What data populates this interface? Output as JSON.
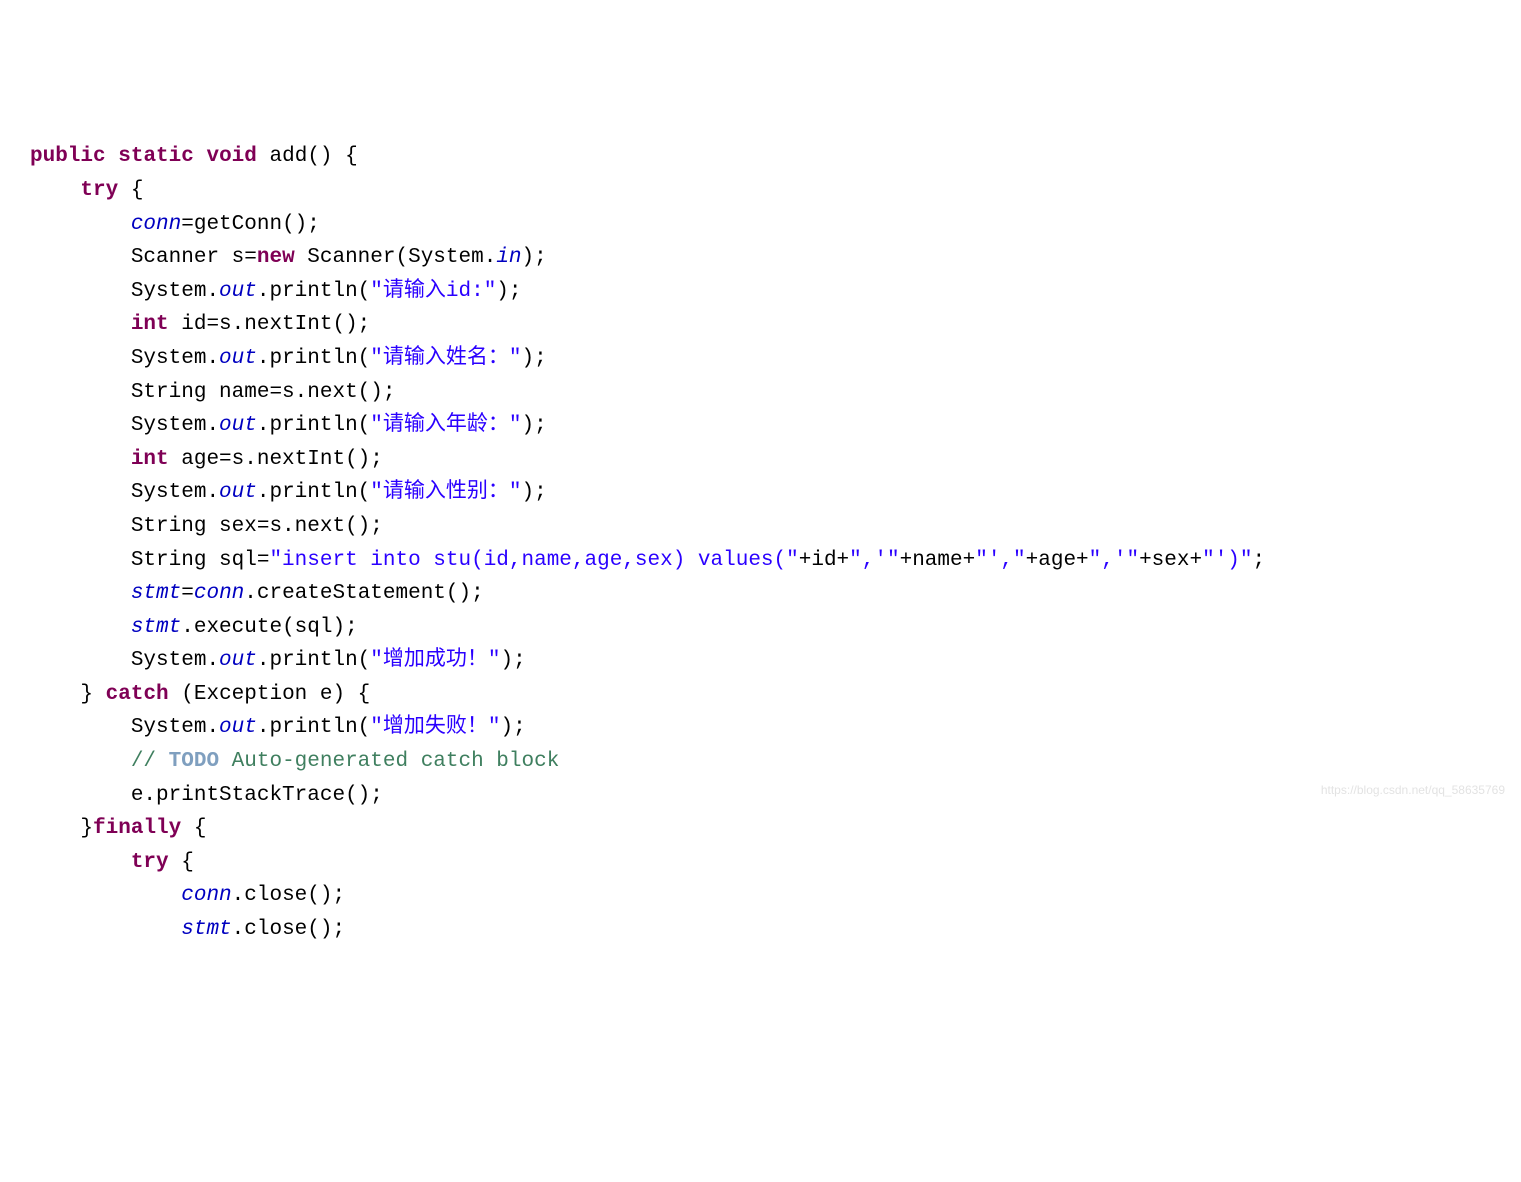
{
  "code": {
    "l1": {
      "kw_public": "public",
      "kw_static": "static",
      "kw_void": "void",
      "name": "add",
      "brace": "() {"
    },
    "l2": {
      "kw_try": "try",
      "brace": " {"
    },
    "l3": {
      "conn": "conn",
      "rest": "=getConn();"
    },
    "l4": {
      "p1": "Scanner s=",
      "kw_new": "new",
      "p2": " Scanner(System.",
      "in": "in",
      "p3": ");"
    },
    "l5": {
      "p1": "System.",
      "out": "out",
      "p2": ".println(",
      "str": "\"请输入id:\"",
      "p3": ");"
    },
    "l6": {
      "kw_int": "int",
      "rest": " id=s.nextInt();"
    },
    "l7": {
      "p1": "System.",
      "out": "out",
      "p2": ".println(",
      "str": "\"请输入姓名：\"",
      "p3": ");"
    },
    "l8": {
      "txt": "String name=s.next();"
    },
    "l9": {
      "p1": "System.",
      "out": "out",
      "p2": ".println(",
      "str": "\"请输入年龄：\"",
      "p3": ");"
    },
    "l10": {
      "kw_int": "int",
      "rest": " age=s.nextInt();"
    },
    "l11": {
      "p1": "System.",
      "out": "out",
      "p2": ".println(",
      "str": "\"请输入性别：\"",
      "p3": ");"
    },
    "l12": {
      "txt": "String sex=s.next();"
    },
    "l13": {
      "p1": "String sql=",
      "s1": "\"insert into stu(id,name,age,sex) values(\"",
      "p2": "+id+",
      "s2": "\",'\"",
      "p3": "+name+",
      "s3": "\"',\"",
      "p4": "+age+",
      "s4": "\",'\"",
      "p5": "+sex+",
      "s5": "\"')\"",
      "p6": ";"
    },
    "l14": {
      "stmt": "stmt",
      "eq": "=",
      "conn": "conn",
      "rest": ".createStatement();"
    },
    "l15": {
      "stmt": "stmt",
      "rest": ".execute(sql);"
    },
    "l16": {
      "p1": "System.",
      "out": "out",
      "p2": ".println(",
      "str": "\"增加成功！\"",
      "p3": ");"
    },
    "l17": {
      "p1": "} ",
      "kw_catch": "catch",
      "p2": " (Exception e) {"
    },
    "l18": {
      "p1": "System.",
      "out": "out",
      "p2": ".println(",
      "str": "\"增加失败！\"",
      "p3": ");"
    },
    "l19": {
      "c1": "// ",
      "todo": "TODO",
      "c2": " Auto-generated catch block"
    },
    "l20": {
      "txt": "e.printStackTrace();"
    },
    "l21": {
      "p1": "}",
      "kw_finally": "finally",
      "p2": " {"
    },
    "l22": {
      "kw_try": "try",
      "brace": " {"
    },
    "l23": {
      "conn": "conn",
      "rest": ".close();"
    },
    "l24": {
      "stmt": "stmt",
      "rest": ".close();"
    }
  },
  "watermark": "https://blog.csdn.net/qq_58635769"
}
